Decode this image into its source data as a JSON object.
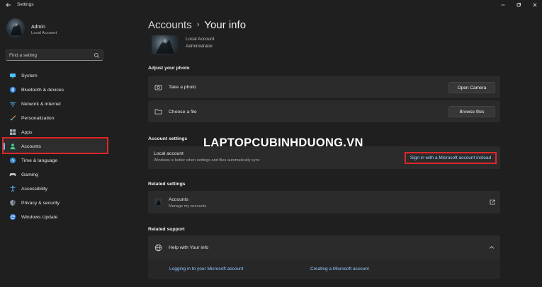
{
  "window": {
    "title": "Settings"
  },
  "profile": {
    "name": "Admin",
    "type": "Local Account"
  },
  "search": {
    "placeholder": "Find a setting"
  },
  "sidebar": {
    "items": [
      {
        "label": "System",
        "icon": "monitor-icon",
        "color": "#4cc2ff"
      },
      {
        "label": "Bluetooth & devices",
        "icon": "bluetooth-icon",
        "color": "#3b9cf0"
      },
      {
        "label": "Network & internet",
        "icon": "wifi-icon",
        "color": "#5ab0f0"
      },
      {
        "label": "Personalization",
        "icon": "brush-icon",
        "color": "#e8a24a"
      },
      {
        "label": "Apps",
        "icon": "apps-icon",
        "color": "#aab4be"
      },
      {
        "label": "Accounts",
        "icon": "person-icon",
        "color": "#3ec98a"
      },
      {
        "label": "Time & language",
        "icon": "globe-clock-icon",
        "color": "#4aa7e8"
      },
      {
        "label": "Gaming",
        "icon": "gamepad-icon",
        "color": "#b8c0c8"
      },
      {
        "label": "Accessibility",
        "icon": "accessibility-icon",
        "color": "#4cb0f5"
      },
      {
        "label": "Privacy & security",
        "icon": "shield-icon",
        "color": "#9aa6b2"
      },
      {
        "label": "Windows Update",
        "icon": "refresh-icon",
        "color": "#3b9cf0"
      }
    ],
    "active": "Accounts"
  },
  "breadcrumb": {
    "parent": "Accounts",
    "separator": "›",
    "current": "Your info"
  },
  "account": {
    "type": "Local Account",
    "role": "Administrator"
  },
  "adjust_photo": {
    "title": "Adjust your photo",
    "take_photo": {
      "label": "Take a photo",
      "button": "Open Camera"
    },
    "choose_file": {
      "label": "Choose a file",
      "button": "Browse files"
    }
  },
  "account_settings": {
    "title": "Account settings",
    "label": "Local account",
    "description": "Windows is better when settings and files automatically sync",
    "signin_link": "Sign in with a Microsoft account instead"
  },
  "watermark": "LAPTOPCUBINHDUONG.VN",
  "related_settings": {
    "title": "Related settings",
    "accounts": {
      "label": "Accounts",
      "description": "Manage my accounts"
    }
  },
  "related_support": {
    "title": "Related support",
    "help": {
      "label": "Help with Your info"
    },
    "links": [
      "Logging in to your Microsoft account",
      "Creating a Microsoft account"
    ]
  },
  "colors": {
    "background": "#1f1f1f",
    "card": "#2b2b2b",
    "accent_link": "#9fd4ff",
    "highlight_border": "#e0262a"
  }
}
